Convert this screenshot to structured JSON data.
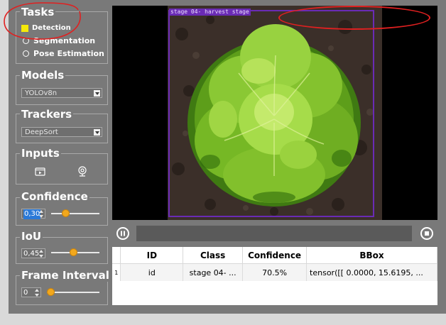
{
  "sidebar": {
    "tasks": {
      "title": "Tasks",
      "options": [
        {
          "label": "Detection",
          "selected": true
        },
        {
          "label": "Segmentation",
          "selected": false
        },
        {
          "label": "Pose Estimation",
          "selected": false
        }
      ]
    },
    "models": {
      "title": "Models",
      "selected": "YOLOv8n"
    },
    "trackers": {
      "title": "Trackers",
      "selected": "DeepSort"
    },
    "inputs": {
      "title": "Inputs",
      "icons": [
        "video-file-icon",
        "webcam-icon"
      ]
    },
    "confidence": {
      "title": "Confidence",
      "value": "0,30",
      "slider_value": 0.3
    },
    "iou": {
      "title": "IoU",
      "value": "0,45",
      "slider_value": 0.45
    },
    "frame_interval": {
      "title": "Frame Interval",
      "value": "0",
      "slider_value": 0
    }
  },
  "viewer": {
    "bbox_label": "stage 04- harvest stage"
  },
  "controls": {
    "icons": [
      "pause-icon",
      "stop-icon"
    ]
  },
  "results": {
    "columns": [
      "ID",
      "Class",
      "Confidence",
      "BBox"
    ],
    "rows": [
      {
        "row": "1",
        "id": "id",
        "class": "stage 04- ...",
        "confidence": "70.5%",
        "bbox": "tensor([[   0.0000,   15.6195, ..."
      }
    ]
  },
  "colors": {
    "selection": "#f5e90a",
    "accent": "#f2a81d",
    "bbox": "#6a2bb5",
    "annotation": "#e02020"
  }
}
